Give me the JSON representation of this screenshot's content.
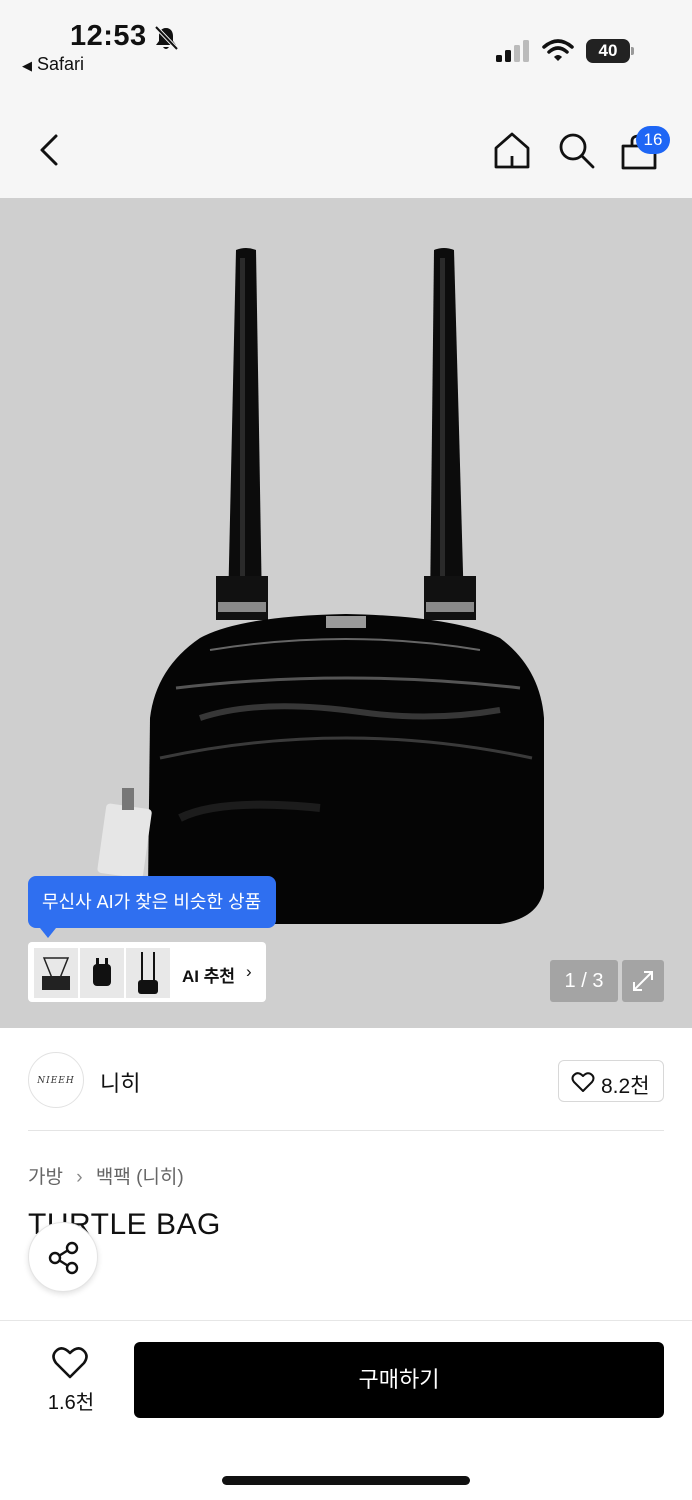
{
  "status_bar": {
    "time": "12:53",
    "back_app": "Safari",
    "battery": "40"
  },
  "nav": {
    "cart_count": "16"
  },
  "gallery": {
    "ai_tooltip": "무신사 AI가 찾은 비슷한 상품",
    "ai_recommend_label": "AI 추천",
    "ai_recommend_chevron": "›",
    "page_indicator": "1 / 3"
  },
  "brand": {
    "logo_text": "NIEEH",
    "name": "니히",
    "like_count": "8.2천"
  },
  "product": {
    "breadcrumb": [
      "가방",
      "백팩 (니히)"
    ],
    "breadcrumb_sep": "›",
    "title": "TURTLE BAG"
  },
  "bottom_bar": {
    "wish_count": "1.6천",
    "buy_label": "구매하기"
  },
  "colors": {
    "accent_blue": "#2f6ff0",
    "badge_blue": "#1e66f5",
    "buy_button": "#000000",
    "image_bg": "#cfcfcf"
  }
}
